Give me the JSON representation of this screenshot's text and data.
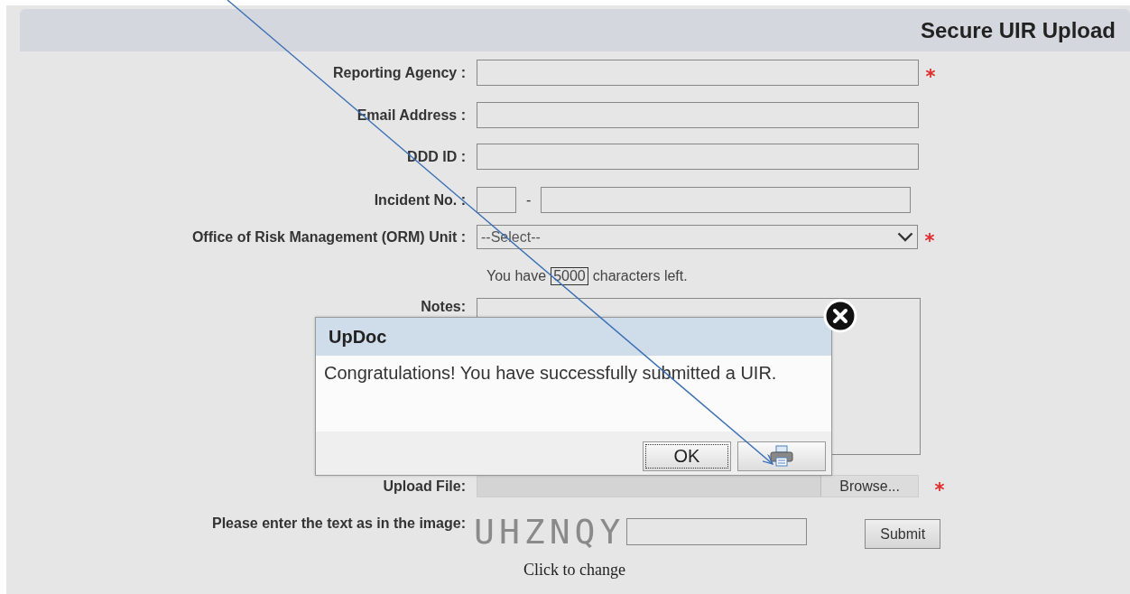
{
  "page": {
    "title": "Secure UIR Upload"
  },
  "form": {
    "fields": [
      {
        "label": "Reporting Agency :",
        "kind": "text",
        "required": true
      },
      {
        "label": "Email Address :",
        "kind": "text",
        "required": false
      },
      {
        "label": "DDD ID :",
        "kind": "text",
        "required": false
      },
      {
        "label": "Incident No. :",
        "kind": "split",
        "separator": "-",
        "required": false
      },
      {
        "label": "Office of Risk Management (ORM) Unit :",
        "kind": "select",
        "value": "--Select--",
        "required": true
      }
    ],
    "counter": {
      "before": "You have",
      "count": "5000",
      "after": "characters left."
    },
    "notes": {
      "label": "Notes:"
    },
    "upload": {
      "label": "Upload File:",
      "button": "Browse...",
      "required": true
    },
    "captcha": {
      "label": "Please enter the text as in the image:",
      "image_text": "UHZNQY",
      "submit": "Submit",
      "change_link": "Click to change"
    }
  },
  "dialog": {
    "title": "UpDoc",
    "message": "Congratulations! You have successfully submitted a UIR.",
    "buttons": [
      {
        "kind": "text",
        "label": "OK"
      },
      {
        "kind": "print"
      }
    ]
  }
}
